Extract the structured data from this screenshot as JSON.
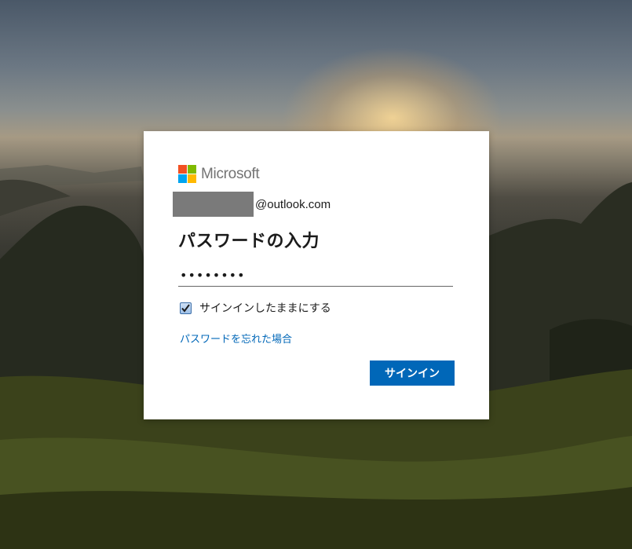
{
  "brand": {
    "name": "Microsoft",
    "colors": [
      "#f25022",
      "#7fba00",
      "#00a4ef",
      "#ffb900"
    ]
  },
  "account": {
    "domain": "@outlook.com"
  },
  "title": "パスワードの入力",
  "password": {
    "value": "••••••••"
  },
  "keep_signed_in": {
    "label": "サインインしたままにする",
    "checked": true
  },
  "forgot_link": "パスワードを忘れた場合",
  "signin_button": "サインイン",
  "accent_color": "#0067b8"
}
